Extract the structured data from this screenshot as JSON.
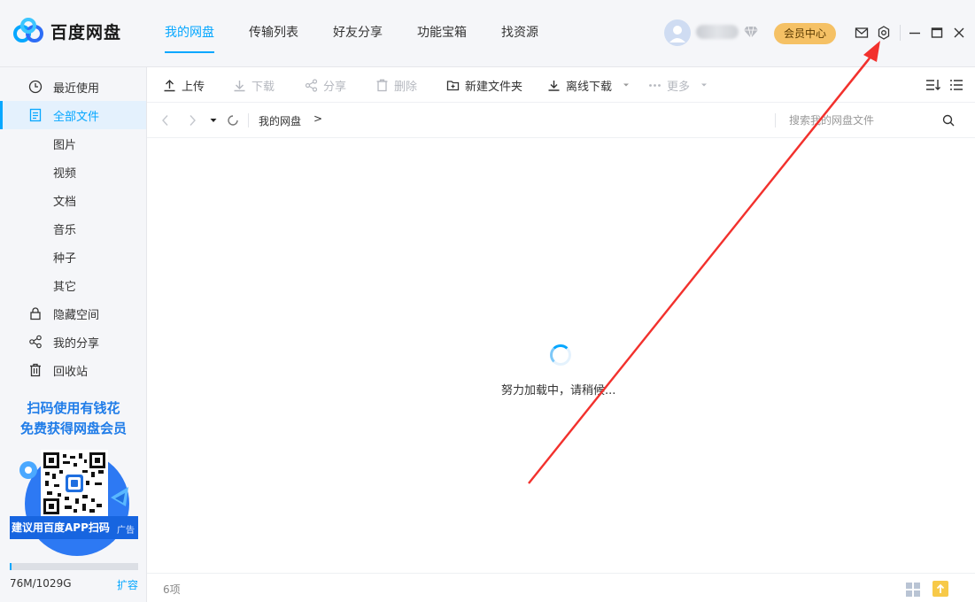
{
  "app": {
    "logo_text": "百度网盘"
  },
  "nav": {
    "tabs": [
      {
        "label": "我的网盘",
        "active": true
      },
      {
        "label": "传输列表",
        "active": false
      },
      {
        "label": "好友分享",
        "active": false
      },
      {
        "label": "功能宝箱",
        "active": false
      },
      {
        "label": "找资源",
        "active": false
      }
    ]
  },
  "header": {
    "vip_label": "会员中心",
    "icons": [
      "avatar",
      "vip-diamond-icon",
      "mail-icon",
      "settings-icon",
      "minimize-icon",
      "maximize-icon",
      "close-icon"
    ]
  },
  "sidebar": {
    "items": [
      {
        "label": "最近使用",
        "icon": "clock-icon"
      },
      {
        "label": "全部文件",
        "icon": "document-icon",
        "active": true
      },
      {
        "label": "图片"
      },
      {
        "label": "视频"
      },
      {
        "label": "文档"
      },
      {
        "label": "音乐"
      },
      {
        "label": "种子"
      },
      {
        "label": "其它"
      },
      {
        "label": "隐藏空间",
        "icon": "lock-icon"
      },
      {
        "label": "我的分享",
        "icon": "share-icon"
      },
      {
        "label": "回收站",
        "icon": "trash-icon"
      }
    ],
    "promo": {
      "line1": "扫码使用有钱花",
      "line2": "免费获得网盘会员",
      "bar_text": "建议用百度APP扫码",
      "ad_label": "广告"
    },
    "storage": {
      "text": "76M/1029G",
      "used_fraction": 0.01,
      "expand_label": "扩容"
    }
  },
  "toolbar": {
    "upload": "上传",
    "download": "下载",
    "share": "分享",
    "delete": "删除",
    "new_folder": "新建文件夹",
    "offline_download": "离线下载",
    "more": "更多"
  },
  "address": {
    "breadcrumb": "我的网盘",
    "separator": ">",
    "search_placeholder": "搜索我的网盘文件"
  },
  "main": {
    "loading_text": "努力加载中，请稍候..."
  },
  "status": {
    "item_count": "6项"
  },
  "colors": {
    "accent": "#06a7ff",
    "vip_gold": "#f5c165",
    "annotation_red": "#f2312d"
  }
}
